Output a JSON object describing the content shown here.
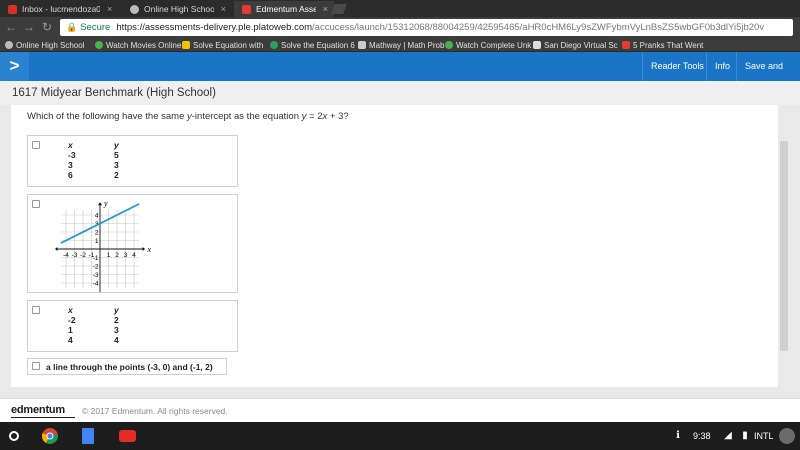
{
  "browser": {
    "tabs": [
      {
        "title": "Inbox - lucmendoza09@",
        "favicon_color": "#d93025",
        "active": false
      },
      {
        "title": "Online High School | Sa",
        "favicon_color": "#bbbbbb",
        "active": false
      },
      {
        "title": "Edmentum Assessment",
        "favicon_color": "#e53935",
        "active": true
      }
    ],
    "close_glyph": "×",
    "secure_label": "Secure",
    "url_host": "https://assessments-delivery.ple.platoweb.com",
    "url_path": "/accucess/launch/15312068/88004259/42595465/aHR0cHM6Ly9sZWFybmVyLnBsZS5wbGF0b3dlYi5jb20v",
    "bookmarks": [
      {
        "label": "Online High School",
        "favicon_color": "#bbbbbb"
      },
      {
        "label": "Watch Movies Online",
        "favicon_color": "#4caf50"
      },
      {
        "label": "Solve Equation with",
        "favicon_color": "#f2c200"
      },
      {
        "label": "Solve the Equation 6",
        "favicon_color": "#2e9d5b"
      },
      {
        "label": "Mathway | Math Prob",
        "favicon_color": "#cccccc"
      },
      {
        "label": "Watch Complete Unk",
        "favicon_color": "#4caf50"
      },
      {
        "label": "San Diego Virtual Sc",
        "favicon_color": "#dddddd"
      },
      {
        "label": "5 Pranks That Went",
        "favicon_color": "#e53935"
      }
    ]
  },
  "app": {
    "nav": {
      "reader_tools": "Reader Tools",
      "info": "Info",
      "save_exit": "Save and Exit"
    },
    "page_title": "1617 Midyear Benchmark (High School)",
    "question": {
      "prefix": "Which of the following have the same ",
      "var_y": "y",
      "middle": "-intercept as the equation ",
      "equation_lhs": "y",
      "equation_rhs": " = 2",
      "equation_x": "x",
      "equation_tail": " + 3?"
    },
    "options": {
      "table1": {
        "header_x": "x",
        "header_y": "y",
        "rows": [
          [
            "-3",
            "5"
          ],
          [
            "3",
            "3"
          ],
          [
            "6",
            "2"
          ]
        ]
      },
      "graph": {
        "x_axis_label": "x",
        "y_axis_label": "y",
        "x_tick_labels": [
          "-4",
          "-3",
          "-2",
          "-1",
          "1",
          "2",
          "3",
          "4"
        ],
        "y_tick_labels": [
          "4",
          "3",
          "2",
          "1",
          "-1",
          "-2",
          "-3",
          "-4"
        ],
        "line_color": "#2a9bd1"
      },
      "table2": {
        "header_x": "x",
        "header_y": "y",
        "rows": [
          [
            "-2",
            "2"
          ],
          [
            "1",
            "3"
          ],
          [
            "4",
            "4"
          ]
        ]
      },
      "text_option": "a line through the points (-3, 0) and (-1, 2)"
    }
  },
  "footer": {
    "logo": "edmentum",
    "copyright": "© 2017 Edmentum. All rights reserved."
  },
  "taskbar": {
    "time": "9:38",
    "keyboard": "INTL"
  }
}
